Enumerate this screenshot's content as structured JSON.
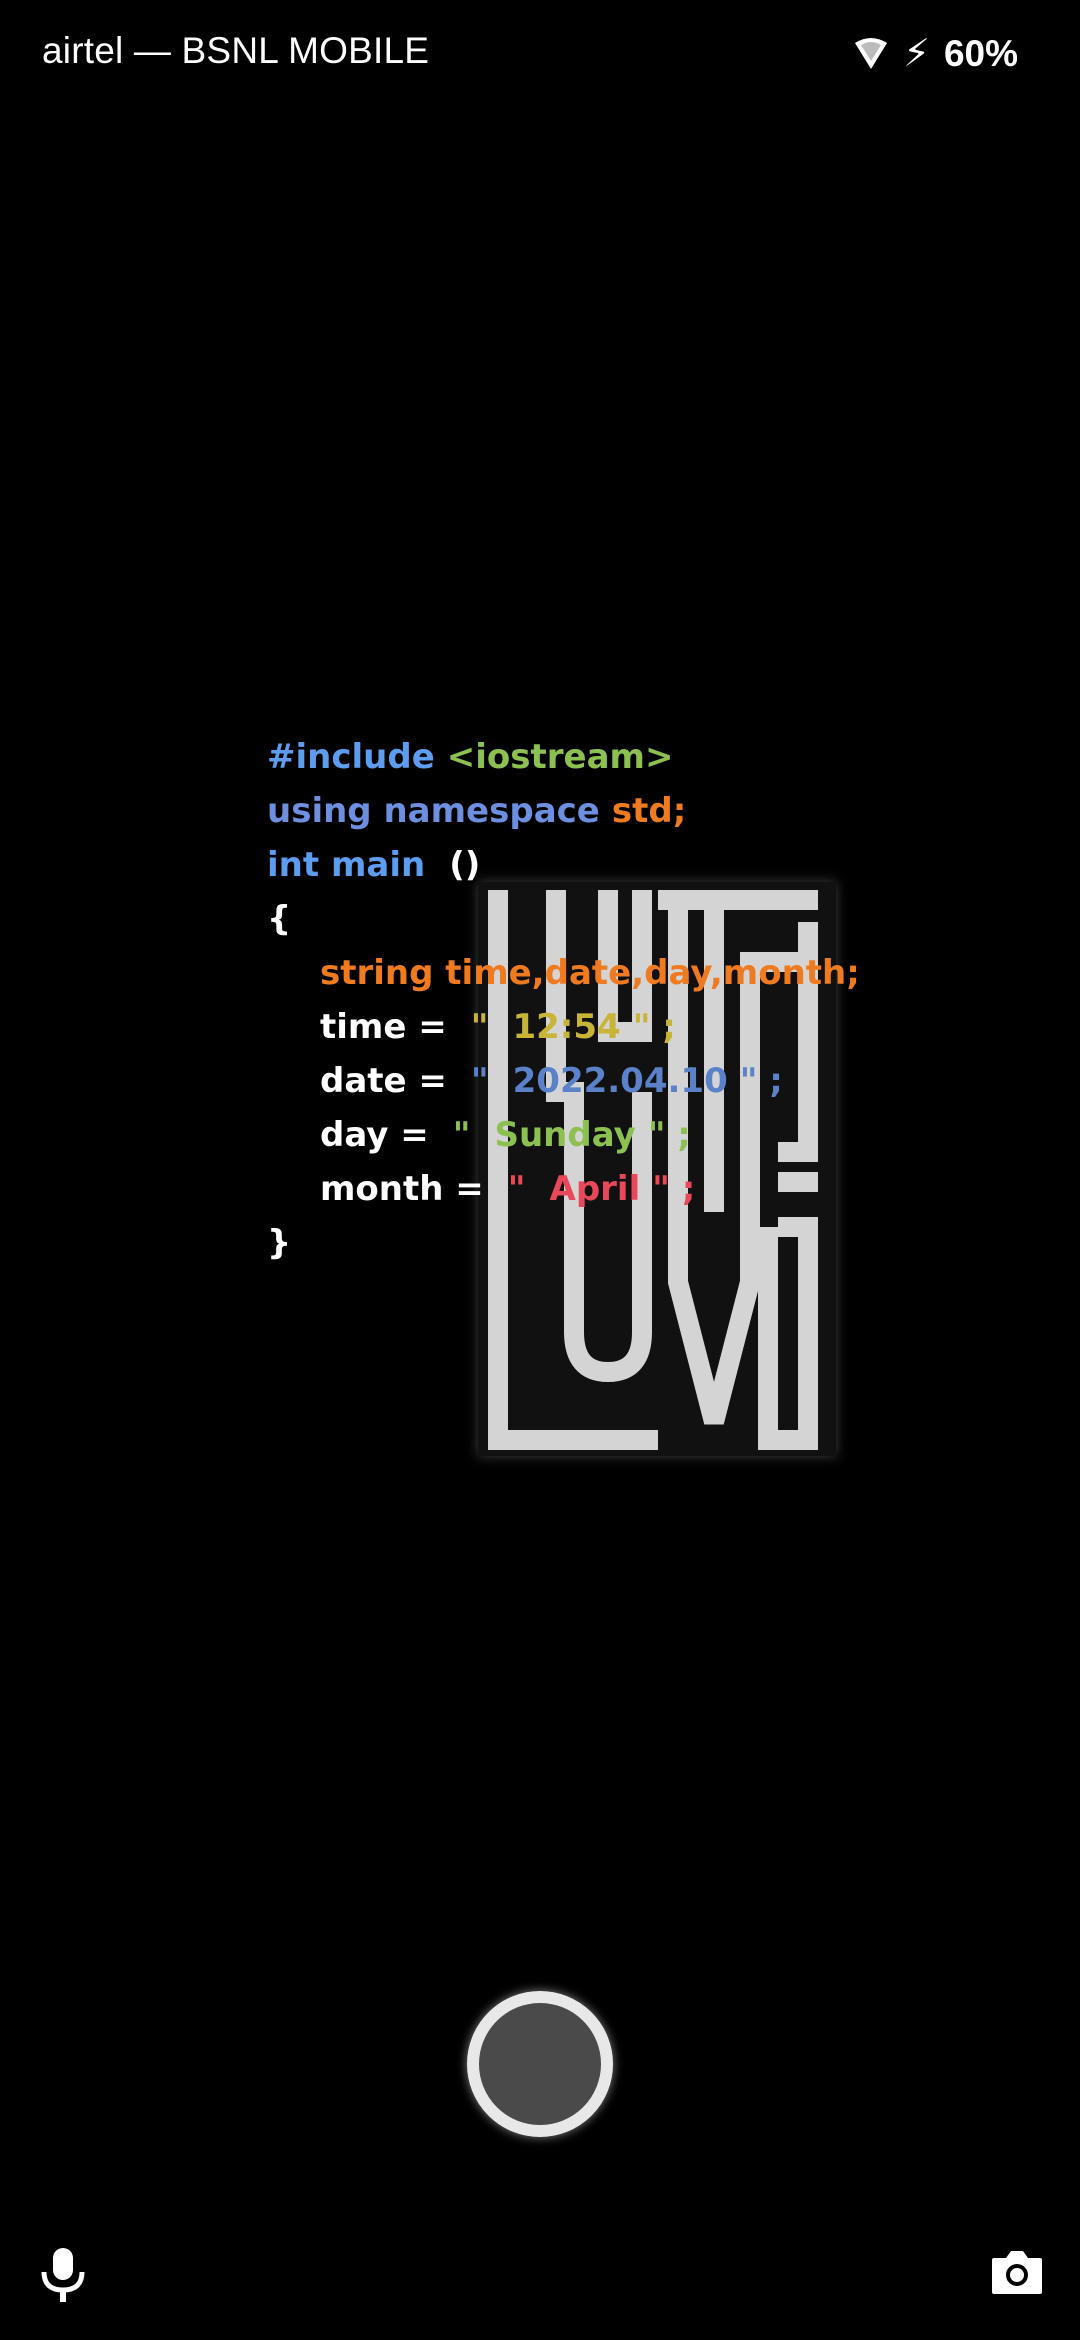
{
  "status_bar": {
    "carrier": "airtel — BSNL MOBILE",
    "battery": "60%",
    "icons": [
      "wifi-icon",
      "charging-bolt-icon"
    ]
  },
  "wallpaper_code": {
    "line1": {
      "kw": "#include",
      "lib": "<iostream>"
    },
    "line2": {
      "kw": "using namespace",
      "std": "std;"
    },
    "line3": {
      "kw": "int main",
      "parens": "()"
    },
    "open_brace": "{",
    "decl": "string time,date,day,month;",
    "assignments": [
      {
        "name": "time =",
        "q1": "\"",
        "value": "12:54",
        "end": "\" ;",
        "color": "#c8b537"
      },
      {
        "name": "date =",
        "q1": "\"",
        "value": "2022.04.10",
        "end": "\" ;",
        "color": "#5b82c8"
      },
      {
        "name": "day =",
        "q1": "\"",
        "value": "Sunday",
        "end": "\" ;",
        "color": "#8cc152"
      },
      {
        "name": "month =",
        "q1": "\"",
        "value": "April",
        "end": "\" ;",
        "color": "#e8485a"
      }
    ],
    "close_brace": "}"
  },
  "artwork": {
    "text": "LOVE HATE"
  },
  "colors": {
    "keyword_blue": "#5c9df0",
    "namespace_blue": "#6d8fe0",
    "string_green": "#8cc152",
    "orange": "#ef7b21"
  },
  "bottom_controls": {
    "left_icon": "microphone-icon",
    "right_icon": "camera-icon",
    "center": "home-button"
  }
}
